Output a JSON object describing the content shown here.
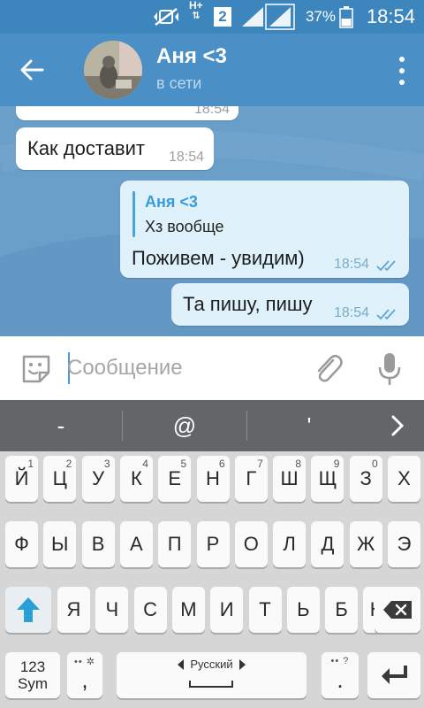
{
  "status_bar": {
    "network_type": "H+",
    "sim_slot": "2",
    "battery_percent": "37%",
    "time": "18:54",
    "icons": [
      "mute-vibrate-icon",
      "data-arrows-icon",
      "signal-icon",
      "signal-icon",
      "battery-icon"
    ]
  },
  "header": {
    "title": "Аня <3",
    "status": "в сети",
    "icons": [
      "back-arrow-icon",
      "avatar",
      "more-vert-icon"
    ]
  },
  "messages": [
    {
      "type": "in",
      "text": "",
      "time": "18:54"
    },
    {
      "type": "in",
      "text": "Как доставит",
      "time": "18:54"
    },
    {
      "type": "out",
      "reply_name": "Аня <3",
      "reply_text": "Хз вообще",
      "text": "Поживем - увидим)",
      "time": "18:54"
    },
    {
      "type": "out",
      "text": "Та пишу, пишу",
      "time": "18:54"
    }
  ],
  "composer": {
    "placeholder": "Сообщение",
    "value": "",
    "icons": [
      "sticker-icon",
      "attach-icon",
      "mic-icon"
    ]
  },
  "suggestions": {
    "items": [
      "-",
      "@",
      "'"
    ],
    "icon": "chevron-right-icon"
  },
  "keyboard": {
    "row1": [
      {
        "l": "Й",
        "n": "1"
      },
      {
        "l": "Ц",
        "n": "2"
      },
      {
        "l": "У",
        "n": "3"
      },
      {
        "l": "К",
        "n": "4"
      },
      {
        "l": "Е",
        "n": "5"
      },
      {
        "l": "Н",
        "n": "6"
      },
      {
        "l": "Г",
        "n": "7"
      },
      {
        "l": "Ш",
        "n": "8"
      },
      {
        "l": "Щ",
        "n": "9"
      },
      {
        "l": "З",
        "n": "0"
      },
      {
        "l": "Х",
        "n": ""
      }
    ],
    "row2": [
      "Ф",
      "Ы",
      "В",
      "А",
      "П",
      "Р",
      "О",
      "Л",
      "Д",
      "Ж",
      "Э"
    ],
    "row3": [
      "Я",
      "Ч",
      "С",
      "М",
      "И",
      "Т",
      "Ь",
      "Б",
      "Ю"
    ],
    "sym_key": [
      "123",
      "Sym"
    ],
    "comma_key": ",",
    "space_language": "Русский",
    "period_key": ".",
    "icons": [
      "shift-icon",
      "backspace-icon",
      "enter-icon",
      "settings-icon"
    ],
    "colors": {
      "shift_arrow": "#2a9fd6",
      "key_bg": "#fafafa",
      "keyboard_bg": "#d6d6d6"
    }
  },
  "colors": {
    "status_bar": "#3d86bd",
    "app_bar": "#4a8fc5",
    "outgoing_bubble": "#dff2fc",
    "incoming_bubble": "#ffffff",
    "read_checks": "#5aa6db"
  }
}
